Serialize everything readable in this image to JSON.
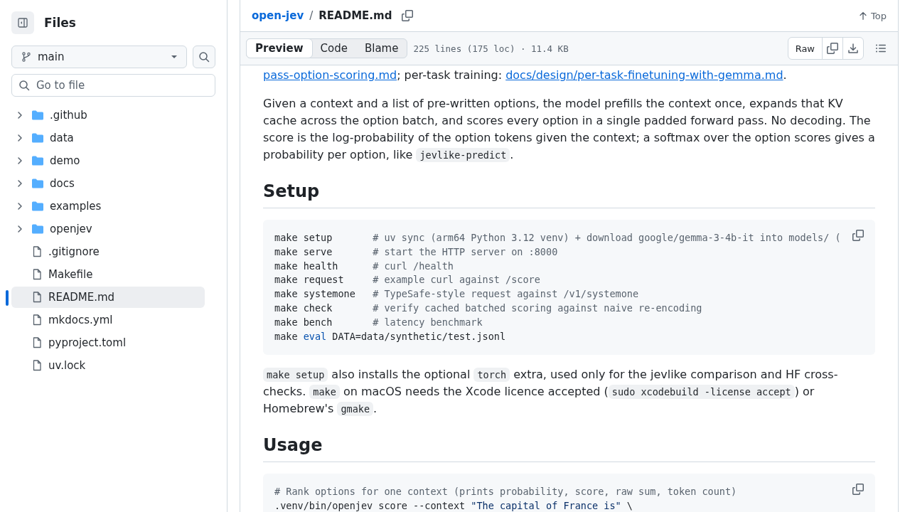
{
  "sidebar": {
    "title": "Files",
    "branch": "main",
    "file_search": {
      "placeholder": "Go to file"
    },
    "tree": [
      {
        "name": ".github",
        "kind": "folder",
        "expanded": false,
        "selected": false
      },
      {
        "name": "data",
        "kind": "folder",
        "expanded": false,
        "selected": false
      },
      {
        "name": "demo",
        "kind": "folder",
        "expanded": false,
        "selected": false
      },
      {
        "name": "docs",
        "kind": "folder",
        "expanded": false,
        "selected": false
      },
      {
        "name": "examples",
        "kind": "folder",
        "expanded": false,
        "selected": false
      },
      {
        "name": "openjev",
        "kind": "folder",
        "expanded": false,
        "selected": false
      },
      {
        "name": ".gitignore",
        "kind": "file",
        "selected": false
      },
      {
        "name": "Makefile",
        "kind": "file",
        "selected": false
      },
      {
        "name": "README.md",
        "kind": "file",
        "selected": true
      },
      {
        "name": "mkdocs.yml",
        "kind": "file",
        "selected": false
      },
      {
        "name": "pyproject.toml",
        "kind": "file",
        "selected": false
      },
      {
        "name": "uv.lock",
        "kind": "file",
        "selected": false
      }
    ]
  },
  "header": {
    "repo": "open-jev",
    "separator": "/",
    "file": "README.md",
    "top_label": "Top"
  },
  "toolbar": {
    "tabs": [
      {
        "label": "Preview",
        "selected": true
      },
      {
        "label": "Code",
        "selected": false
      },
      {
        "label": "Blame",
        "selected": false
      }
    ],
    "info": "225 lines (175 loc) · 11.4 KB",
    "raw_label": "Raw"
  },
  "content": [
    {
      "kind": "paragraph",
      "segments": [
        {
          "kind": "link",
          "text": "pass-option-scoring.md"
        },
        {
          "kind": "text",
          "text": "; per-task training: "
        },
        {
          "kind": "link",
          "text": "docs/design/per-task-finetuning-with-gemma.md"
        },
        {
          "kind": "text",
          "text": "."
        }
      ]
    },
    {
      "kind": "paragraph",
      "segments": [
        {
          "kind": "text",
          "text": "Given a context and a list of pre-written options, the model prefills the context once, expands that KV cache across the option batch, and scores every option in a single padded forward pass. No decoding. The score is the log-probability of the option tokens given the context; a softmax over the option scores gives a probability per option, like "
        },
        {
          "kind": "code",
          "text": "jevlike-predict"
        },
        {
          "kind": "text",
          "text": "."
        }
      ]
    },
    {
      "kind": "heading",
      "text": "Setup"
    },
    {
      "kind": "code",
      "lines": [
        [
          {
            "kind": "plain",
            "text": "make setup       "
          },
          {
            "kind": "comment",
            "text": "# uv sync (arm64 Python 3.12 venv) + download google/gemma-3-4b-it into models/ ("
          }
        ],
        [
          {
            "kind": "plain",
            "text": "make serve       "
          },
          {
            "kind": "comment",
            "text": "# start the HTTP server on :8000"
          }
        ],
        [
          {
            "kind": "plain",
            "text": "make health      "
          },
          {
            "kind": "comment",
            "text": "# curl /health"
          }
        ],
        [
          {
            "kind": "plain",
            "text": "make request     "
          },
          {
            "kind": "comment",
            "text": "# example curl against /score"
          }
        ],
        [
          {
            "kind": "plain",
            "text": "make systemone   "
          },
          {
            "kind": "comment",
            "text": "# TypeSafe-style request against /v1/systemone"
          }
        ],
        [
          {
            "kind": "plain",
            "text": "make check       "
          },
          {
            "kind": "comment",
            "text": "# verify cached batched scoring against naive re-encoding"
          }
        ],
        [
          {
            "kind": "plain",
            "text": "make bench       "
          },
          {
            "kind": "comment",
            "text": "# latency benchmark"
          }
        ],
        [
          {
            "kind": "plain",
            "text": "make "
          },
          {
            "kind": "keyword",
            "text": "eval"
          },
          {
            "kind": "plain",
            "text": " DATA=data/synthetic/test.jsonl"
          }
        ]
      ]
    },
    {
      "kind": "paragraph",
      "segments": [
        {
          "kind": "code",
          "text": "make setup"
        },
        {
          "kind": "text",
          "text": " also installs the optional "
        },
        {
          "kind": "code",
          "text": "torch"
        },
        {
          "kind": "text",
          "text": " extra, used only for the jevlike comparison and HF cross-checks. "
        },
        {
          "kind": "code",
          "text": "make"
        },
        {
          "kind": "text",
          "text": " on macOS needs the Xcode licence accepted ("
        },
        {
          "kind": "code",
          "text": "sudo xcodebuild -license accept"
        },
        {
          "kind": "text",
          "text": ") or Homebrew's "
        },
        {
          "kind": "code",
          "text": "gmake"
        },
        {
          "kind": "text",
          "text": "."
        }
      ]
    },
    {
      "kind": "heading",
      "text": "Usage"
    },
    {
      "kind": "code",
      "lines": [
        [
          {
            "kind": "comment",
            "text": "# Rank options for one context (prints probability, score, raw sum, token count)"
          }
        ],
        [
          {
            "kind": "plain",
            "text": ".venv/bin/openjev score --context "
          },
          {
            "kind": "string",
            "text": "\"The capital of France is\""
          },
          {
            "kind": "plain",
            "text": " \\"
          }
        ]
      ]
    }
  ]
}
